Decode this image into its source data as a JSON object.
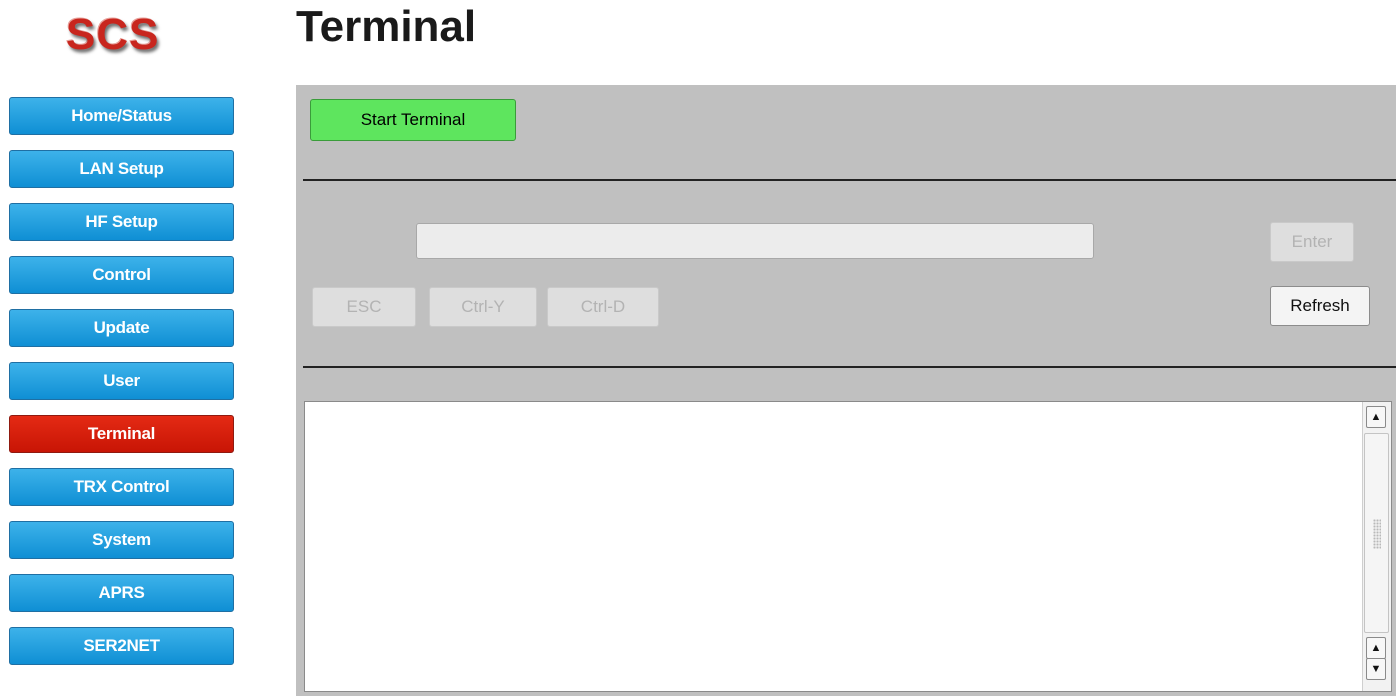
{
  "logo": "SCS",
  "page_title": "Terminal",
  "nav": {
    "items": [
      {
        "label": "Home/Status"
      },
      {
        "label": "LAN Setup"
      },
      {
        "label": "HF Setup"
      },
      {
        "label": "Control"
      },
      {
        "label": "Update"
      },
      {
        "label": "User"
      },
      {
        "label": "Terminal",
        "active": true
      },
      {
        "label": "TRX Control"
      },
      {
        "label": "System"
      },
      {
        "label": "APRS"
      },
      {
        "label": "SER2NET"
      }
    ]
  },
  "terminal": {
    "start_label": "Start Terminal",
    "input_value": "",
    "enter_label": "Enter",
    "esc_label": "ESC",
    "ctrl_y_label": "Ctrl-Y",
    "ctrl_d_label": "Ctrl-D",
    "refresh_label": "Refresh",
    "output_text": ""
  },
  "colors": {
    "nav_blue": "#1a9be0",
    "nav_active_red": "#d81f0c",
    "start_green": "#5ee55e",
    "panel_gray": "#c0c0c0",
    "logo_red": "#c8261e"
  },
  "icons": {
    "scroll_up": "arrow-up-icon",
    "scroll_down": "arrow-down-icon",
    "grip": "grip-icon"
  }
}
